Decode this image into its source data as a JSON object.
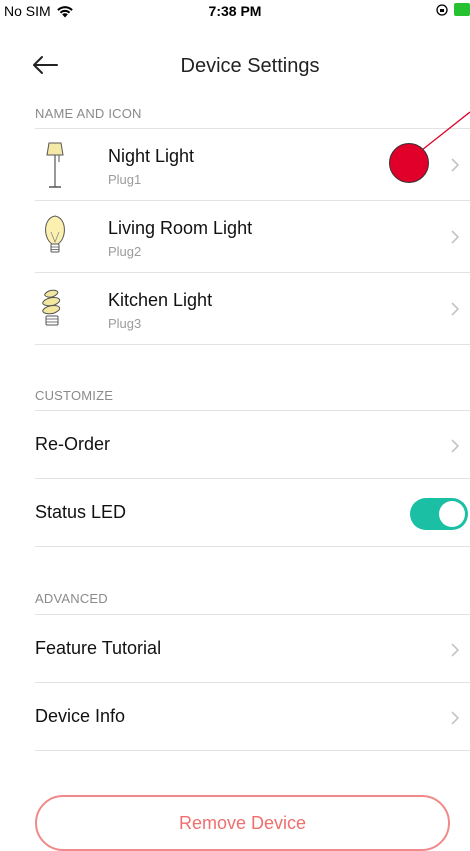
{
  "status_bar": {
    "carrier": "No SIM",
    "time": "7:38 PM",
    "wifi_icon": "wifi-icon",
    "battery_color": "#25c12f"
  },
  "header": {
    "title": "Device Settings",
    "back_icon": "back-arrow-icon"
  },
  "sections": {
    "name_and_icon": "NAME AND ICON",
    "customize": "CUSTOMIZE",
    "advanced": "ADVANCED"
  },
  "devices": [
    {
      "name": "Night Light",
      "plug": "Plug1",
      "icon": "floor-lamp-icon"
    },
    {
      "name": "Living Room Light",
      "plug": "Plug2",
      "icon": "light-bulb-icon"
    },
    {
      "name": "Kitchen Light",
      "plug": "Plug3",
      "icon": "cfl-bulb-icon"
    }
  ],
  "customize": {
    "reorder_label": "Re-Order",
    "status_led_label": "Status LED",
    "status_led_on": true,
    "toggle_color": "#1bbfa3"
  },
  "advanced": {
    "feature_tutorial_label": "Feature Tutorial",
    "device_info_label": "Device Info"
  },
  "remove_button": {
    "label": "Remove Device",
    "color": "#ef6e6e"
  },
  "annotation": {
    "marker_color": "#e0002a"
  }
}
